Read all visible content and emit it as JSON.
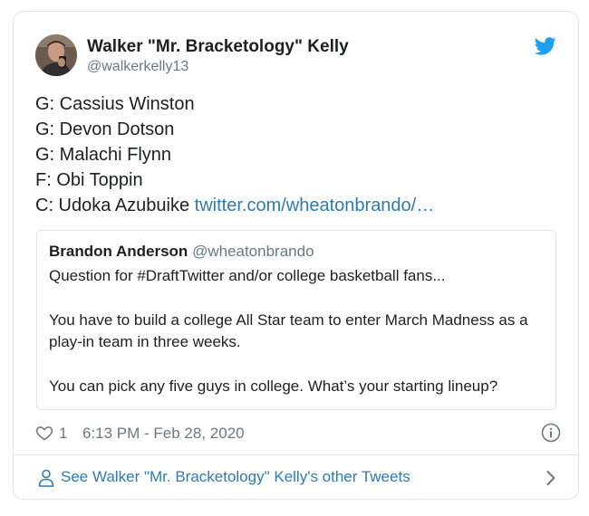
{
  "author": {
    "display_name": "Walker \"Mr. Bracketology\" Kelly",
    "handle": "@walkerkelly13"
  },
  "tweet": {
    "lines": [
      "G: Cassius Winston",
      "G: Devon Dotson",
      "G: Malachi Flynn",
      "F: Obi Toppin",
      "C: Udoka Azubuike "
    ],
    "link_text": "twitter.com/wheatonbrando/…"
  },
  "quoted_tweet": {
    "display_name": "Brandon Anderson",
    "handle": "@wheatonbrando",
    "paragraphs": [
      "Question for #DraftTwitter and/or college basketball fans...",
      "You have to build a college All Star team to enter March Madness as a play-in team in three weeks.",
      "You can pick any five guys in college. What’s your starting lineup?"
    ]
  },
  "meta": {
    "like_count": "1",
    "timestamp": "6:13 PM - Feb 28, 2020"
  },
  "footer": {
    "label": "See Walker \"Mr. Bracketology\" Kelly's other Tweets"
  },
  "icons": {
    "twitter": "twitter-bird-icon",
    "like": "heart-icon",
    "info": "info-icon",
    "profile": "user-icon",
    "more": "chevron-right-icon"
  },
  "colors": {
    "link": "#2b7bb9",
    "twitter_brand": "#1da1f2",
    "secondary_text": "#697882",
    "border": "#e1e8ed"
  }
}
